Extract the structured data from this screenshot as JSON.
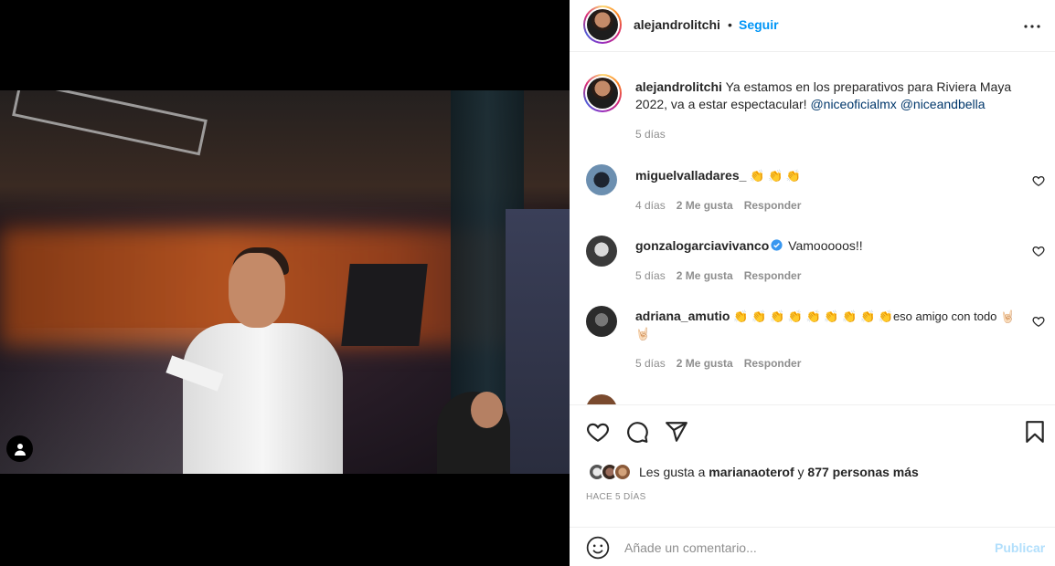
{
  "post": {
    "username": "alejandrolitchi",
    "follow_label": "Seguir",
    "dot": "•"
  },
  "caption": {
    "username": "alejandrolitchi",
    "text": "Ya estamos en los preparativos para Riviera Maya 2022, va a estar espectacular!",
    "mention1": "@niceoficialmx",
    "mention2": "@niceandbella",
    "time": "5 días"
  },
  "comments": [
    {
      "username": "miguelvalladares_",
      "text": "👏 👏 👏",
      "time": "4 días",
      "likes": "2 Me gusta",
      "reply": "Responder",
      "verified": false
    },
    {
      "username": "gonzalogarciavivanco",
      "text": "Vamooooos!!",
      "time": "5 días",
      "likes": "2 Me gusta",
      "reply": "Responder",
      "verified": true
    },
    {
      "username": "adriana_amutio",
      "text": "👏 👏 👏 👏 👏 👏 👏 👏 👏eso amigo con todo 🤘🏻🤘🏻",
      "time": "5 días",
      "likes": "2 Me gusta",
      "reply": "Responder",
      "verified": false
    }
  ],
  "likes": {
    "prefix": "Les gusta a",
    "user": "marianaoterof",
    "joiner": "y",
    "others": "877 personas más"
  },
  "time_ago": "HACE 5 DÍAS",
  "compose": {
    "placeholder": "Añade un comentario...",
    "publish_label": "Publicar"
  },
  "icons": {
    "more": "more-horizontal-icon",
    "like": "heart-icon",
    "comment": "comment-icon",
    "share": "paper-plane-icon",
    "save": "bookmark-icon",
    "emoji": "smiley-icon",
    "user_tag": "user-tag-icon"
  },
  "colors": {
    "link_blue": "#0095f6",
    "mention": "#00376b",
    "muted": "#8e8e8e",
    "publish_disabled": "#b2dffc"
  }
}
